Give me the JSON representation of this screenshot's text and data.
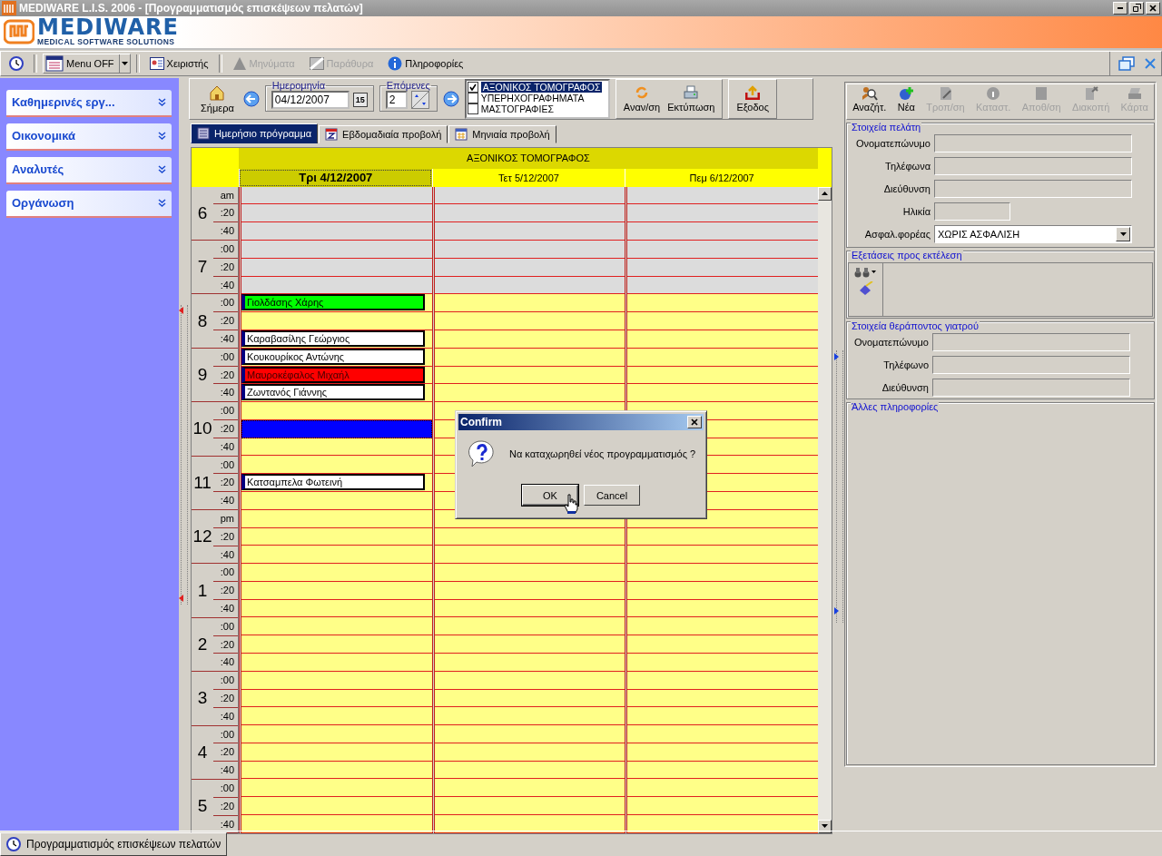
{
  "window": {
    "title": "MEDIWARE L.I.S. 2006 - [Προγραμματισμός επισκέψεων πελατών]"
  },
  "logo": {
    "name": "MEDIWARE",
    "tagline": "MEDICAL SOFTWARE SOLUTIONS"
  },
  "toolbar": [
    {
      "kind": "icon"
    },
    {
      "kind": "dropdown",
      "label": "Menu OFF",
      "disabled": false
    },
    {
      "kind": "button",
      "label": "Χειριστής",
      "disabled": false
    },
    {
      "kind": "button",
      "label": "Μηνύματα",
      "disabled": true
    },
    {
      "kind": "button",
      "label": "Παράθυρα",
      "disabled": true
    },
    {
      "kind": "button",
      "label": "Πληροφορίες",
      "disabled": false
    }
  ],
  "sidebar": {
    "items": [
      {
        "label": "Καθημερινές εργ..."
      },
      {
        "label": "Οικονομικά"
      },
      {
        "label": "Αναλυτές"
      },
      {
        "label": "Οργάνωση"
      }
    ]
  },
  "schedule_toolbar": {
    "today": "Σήμερα",
    "date": {
      "legend": "Ημερομηνία",
      "value": "04/12/2007",
      "calendar_button": "15"
    },
    "count": {
      "legend": "Επόμενες",
      "value": "2"
    },
    "resources": [
      {
        "label": "ΑΞΟΝΙΚΟΣ ΤΟΜΟΓΡΑΦΟΣ",
        "checked": true,
        "selected": true
      },
      {
        "label": "ΥΠΕΡΗΧΟΓΡΑΦΗΜΑΤΑ",
        "checked": false,
        "selected": false
      },
      {
        "label": "ΜΑΣΤΟΓΡΑΦΙΕΣ",
        "checked": false,
        "selected": false
      }
    ],
    "actions": [
      {
        "label": "Αναν/ση"
      },
      {
        "label": "Εκτύπωση"
      },
      {
        "label": "Εξοδος"
      }
    ]
  },
  "tabs": [
    {
      "label": "Ημερήσιο πρόγραμμα",
      "selected": true
    },
    {
      "label": "Εβδομαδιαία προβολή",
      "selected": false
    },
    {
      "label": "Μηνιαία προβολή",
      "selected": false
    }
  ],
  "schedule": {
    "resource": "ΑΞΟΝΙΚΟΣ ΤΟΜΟΓΡΑΦΟΣ",
    "days": [
      {
        "label": "Τρι 4/12/2007",
        "selected": true
      },
      {
        "label": "Τετ 5/12/2007",
        "selected": false
      },
      {
        "label": "Πεμ 6/12/2007",
        "selected": false
      }
    ],
    "hours": [
      {
        "hour": "6",
        "slots": [
          {
            "label": "am",
            "closed": true,
            "selected": false
          },
          {
            "label": ":20",
            "closed": true,
            "selected": false
          },
          {
            "label": ":40",
            "closed": true,
            "selected": false
          }
        ]
      },
      {
        "hour": "7",
        "slots": [
          {
            "label": ":00",
            "closed": true,
            "selected": false
          },
          {
            "label": ":20",
            "closed": true,
            "selected": false
          },
          {
            "label": ":40",
            "closed": true,
            "selected": false
          }
        ]
      },
      {
        "hour": "8",
        "slots": [
          {
            "label": ":00",
            "closed": false,
            "selected": false,
            "appointment": {
              "name": "Γιολδάσης Χάρης",
              "color": "#00ff00"
            }
          },
          {
            "label": ":20",
            "closed": false,
            "selected": false
          },
          {
            "label": ":40",
            "closed": false,
            "selected": false,
            "appointment": {
              "name": "Καραβασίλης Γεώργιος",
              "color": "#ffffff"
            }
          }
        ]
      },
      {
        "hour": "9",
        "slots": [
          {
            "label": ":00",
            "closed": false,
            "selected": false,
            "appointment": {
              "name": "Κουκουρίκος Αντώνης",
              "color": "#ffffff"
            }
          },
          {
            "label": ":20",
            "closed": false,
            "selected": false,
            "appointment": {
              "name": "Μαυροκέφαλος Μιχαήλ",
              "color": "#ff0000"
            }
          },
          {
            "label": ":40",
            "closed": false,
            "selected": false,
            "appointment": {
              "name": "Ζωντανός Γιάννης",
              "color": "#ffffff"
            }
          }
        ]
      },
      {
        "hour": "10",
        "slots": [
          {
            "label": ":00",
            "closed": false,
            "selected": false
          },
          {
            "label": ":20",
            "closed": false,
            "selected": true
          },
          {
            "label": ":40",
            "closed": false,
            "selected": false
          }
        ]
      },
      {
        "hour": "11",
        "slots": [
          {
            "label": ":00",
            "closed": false,
            "selected": false
          },
          {
            "label": ":20",
            "closed": false,
            "selected": false,
            "appointment": {
              "name": "Κατσαμπελα Φωτεινή",
              "color": "#ffffff"
            }
          },
          {
            "label": ":40",
            "closed": false,
            "selected": false
          }
        ]
      },
      {
        "hour": "12",
        "slots": [
          {
            "label": "pm",
            "closed": false,
            "selected": false
          },
          {
            "label": ":20",
            "closed": false,
            "selected": false
          },
          {
            "label": ":40",
            "closed": false,
            "selected": false
          }
        ]
      },
      {
        "hour": "1",
        "slots": [
          {
            "label": ":00",
            "closed": false,
            "selected": false
          },
          {
            "label": ":20",
            "closed": false,
            "selected": false
          },
          {
            "label": ":40",
            "closed": false,
            "selected": false
          }
        ]
      },
      {
        "hour": "2",
        "slots": [
          {
            "label": ":00",
            "closed": false,
            "selected": false
          },
          {
            "label": ":20",
            "closed": false,
            "selected": false
          },
          {
            "label": ":40",
            "closed": false,
            "selected": false
          }
        ]
      },
      {
        "hour": "3",
        "slots": [
          {
            "label": ":00",
            "closed": false,
            "selected": false
          },
          {
            "label": ":20",
            "closed": false,
            "selected": false
          },
          {
            "label": ":40",
            "closed": false,
            "selected": false
          }
        ]
      },
      {
        "hour": "4",
        "slots": [
          {
            "label": ":00",
            "closed": false,
            "selected": false
          },
          {
            "label": ":20",
            "closed": false,
            "selected": false
          },
          {
            "label": ":40",
            "closed": false,
            "selected": false
          }
        ]
      },
      {
        "hour": "5",
        "slots": [
          {
            "label": ":00",
            "closed": false,
            "selected": false
          },
          {
            "label": ":20",
            "closed": false,
            "selected": false
          },
          {
            "label": ":40",
            "closed": false,
            "selected": false
          }
        ]
      }
    ]
  },
  "details": {
    "toolbar": [
      {
        "label": "Αναζήτ.",
        "disabled": false
      },
      {
        "label": "Νέα",
        "disabled": false
      },
      {
        "label": "Τροπ/ση",
        "disabled": true
      },
      {
        "label": "Καταστ.",
        "disabled": true
      },
      {
        "label": "Αποθ/ση",
        "disabled": true
      },
      {
        "label": "Διακοπή",
        "disabled": true
      },
      {
        "label": "Κάρτα",
        "disabled": true
      }
    ],
    "client": {
      "title": "Στοιχεία πελάτη",
      "fields": [
        {
          "label": "Ονοματεπώνυμο",
          "kind": "text"
        },
        {
          "label": "Τηλέφωνα",
          "kind": "text"
        },
        {
          "label": "Διεύθυνση",
          "kind": "text"
        },
        {
          "label": "Ηλικία",
          "kind": "short"
        },
        {
          "label": "Ασφαλ.φορέας",
          "kind": "select",
          "value": "ΧΩΡΙΣ ΑΣΦΑΛΙΣΗ"
        }
      ]
    },
    "exams": {
      "title": "Εξετάσεις προς εκτέλεση"
    },
    "doctor": {
      "title": "Στοιχεία θεράποντος γιατρού",
      "fields": [
        {
          "label": "Ονοματεπώνυμο",
          "kind": "text"
        },
        {
          "label": "Τηλέφωνο",
          "kind": "text"
        },
        {
          "label": "Διεύθυνση",
          "kind": "text"
        }
      ]
    },
    "other": {
      "title": "Άλλες πληροφορίες"
    }
  },
  "dialog": {
    "title": "Confirm",
    "message": "Να καταχωρηθεί νέος προγραμματισμός ?",
    "buttons": [
      {
        "label": "OK",
        "selected": true
      },
      {
        "label": "Cancel",
        "selected": false
      }
    ]
  },
  "taskbar": {
    "items": [
      {
        "label": "Προγραμματισμός επισκέψεων πελατών"
      }
    ]
  }
}
